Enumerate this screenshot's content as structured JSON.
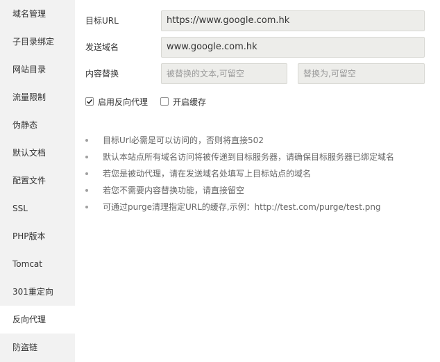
{
  "sidebar": {
    "items": [
      {
        "label": "域名管理"
      },
      {
        "label": "子目录绑定"
      },
      {
        "label": "网站目录"
      },
      {
        "label": "流量限制"
      },
      {
        "label": "伪静态"
      },
      {
        "label": "默认文档"
      },
      {
        "label": "配置文件"
      },
      {
        "label": "SSL"
      },
      {
        "label": "PHP版本"
      },
      {
        "label": "Tomcat"
      },
      {
        "label": "301重定向"
      },
      {
        "label": "反向代理",
        "active": true
      },
      {
        "label": "防盗链"
      }
    ]
  },
  "form": {
    "target_url": {
      "label": "目标URL",
      "value": "https://www.google.com.hk"
    },
    "send_domain": {
      "label": "发送域名",
      "value": "www.google.com.hk"
    },
    "content_replace": {
      "label": "内容替换",
      "replaced_placeholder": "被替换的文本,可留空",
      "replacement_placeholder": "替换为,可留空"
    },
    "enable_proxy": {
      "label": "启用反向代理",
      "checked": true
    },
    "enable_cache": {
      "label": "开启缓存",
      "checked": false
    }
  },
  "tips": [
    "目标Url必需是可以访问的，否则将直接502",
    "默认本站点所有域名访问将被传递到目标服务器，请确保目标服务器已绑定域名",
    "若您是被动代理，请在发送域名处填写上目标站点的域名",
    "若您不需要内容替换功能，请直接留空",
    "可通过purge清理指定URL的缓存,示例：http://test.com/purge/test.png"
  ]
}
